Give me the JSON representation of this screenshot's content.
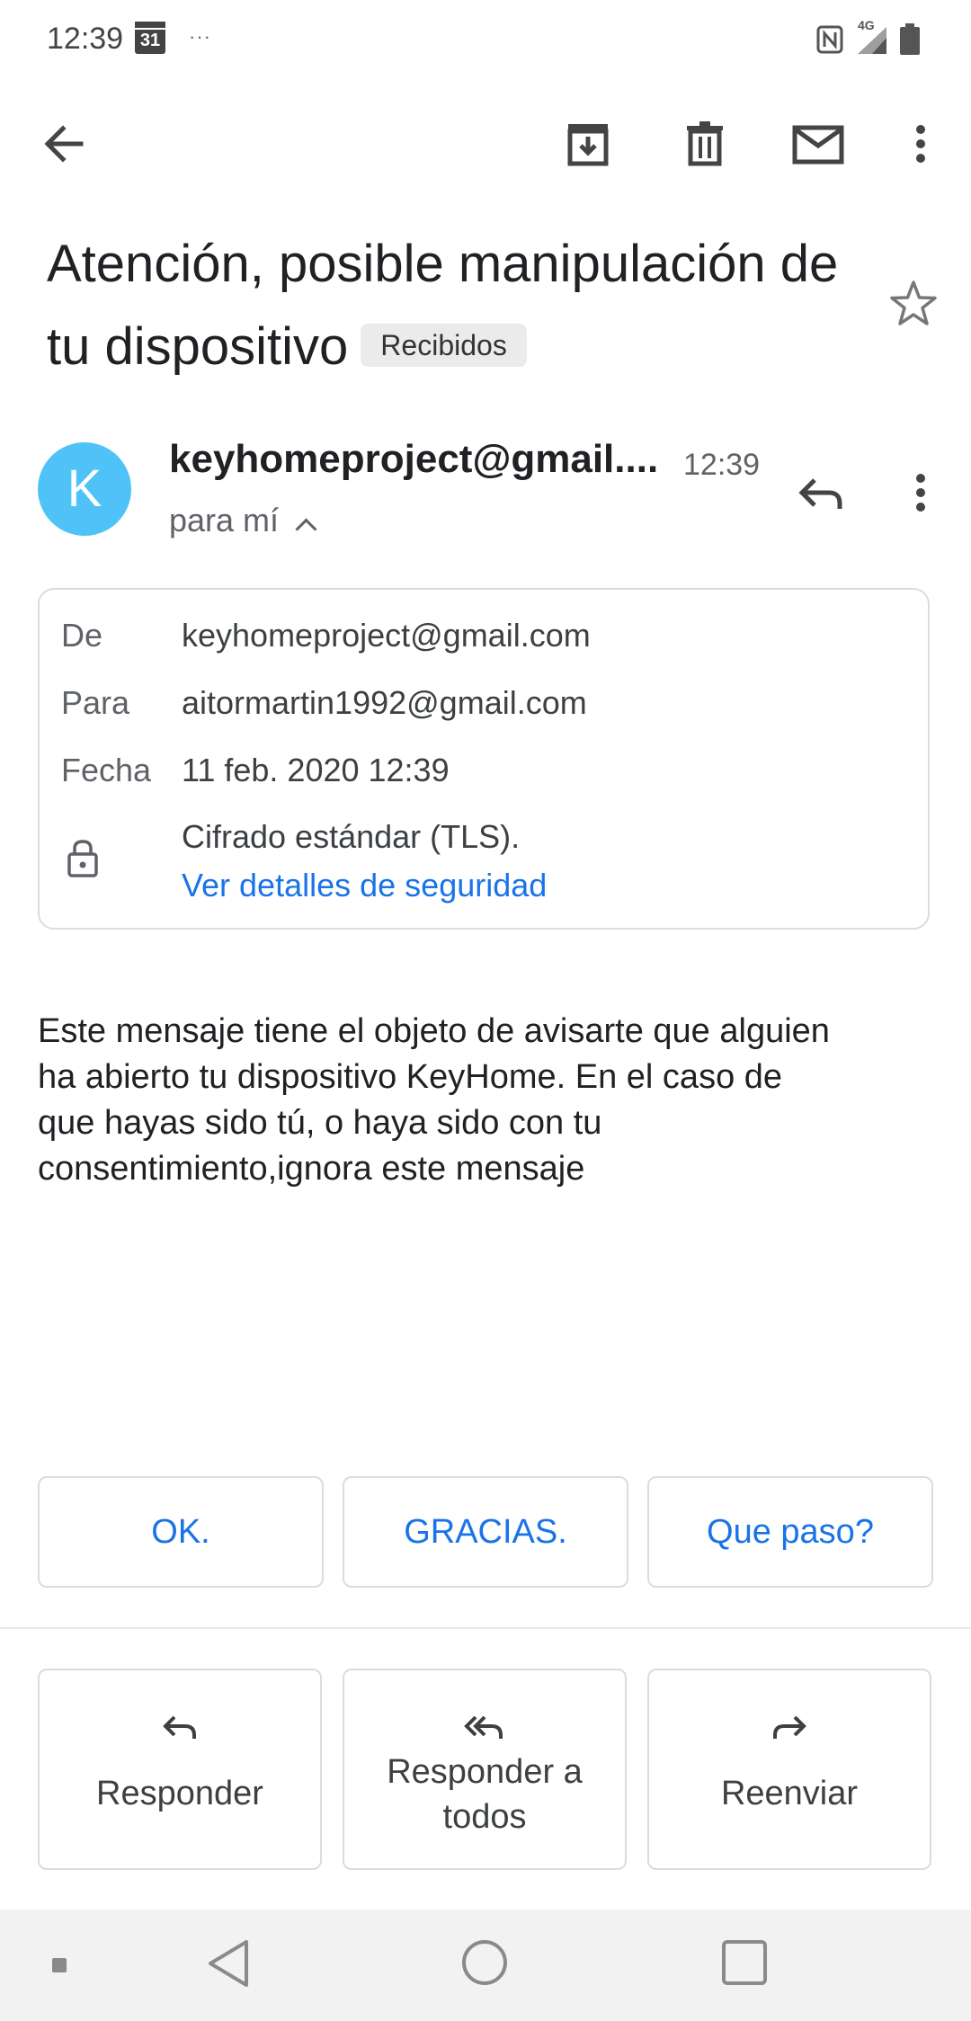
{
  "status_bar": {
    "time": "12:39",
    "calendar_day": "31",
    "overflow_dots": "···",
    "network_type": "4G",
    "icons": [
      "calendar-icon",
      "nfc-icon",
      "signal-icon",
      "battery-icon"
    ]
  },
  "toolbar": {
    "icons": [
      "back-arrow-icon",
      "archive-icon",
      "trash-icon",
      "mail-icon",
      "more-vert-icon"
    ]
  },
  "email": {
    "subject": "Atención, posible manipulación de tu dispositivo",
    "label_chip": "Recibidos",
    "sender_initial": "K",
    "sender_display": "keyhomeproject@gmail....",
    "time": "12:39",
    "recipient_summary": "para mí",
    "details": {
      "from_label": "De",
      "from_value": "keyhomeproject@gmail.com",
      "to_label": "Para",
      "to_value": "aitormartin1992@gmail.com",
      "date_label": "Fecha",
      "date_value": "11 feb. 2020 12:39",
      "encryption": "Cifrado estándar (TLS).",
      "security_link": "Ver detalles de seguridad"
    },
    "body_lines": [
      "Este mensaje tiene el objeto de avisarte que alguien",
      "ha abierto tu dispositivo KeyHome. En el caso de",
      "que hayas sido tú, o haya sido con tu",
      "consentimiento,ignora este mensaje"
    ]
  },
  "smart_replies": [
    "OK.",
    "GRACIAS.",
    "Que paso?"
  ],
  "actions": {
    "reply": "Responder",
    "reply_all_line1": "Responder a",
    "reply_all_line2": "todos",
    "forward": "Reenviar"
  },
  "colors": {
    "accent": "#1a73e8",
    "avatar": "#4fc3f7",
    "border": "#dadce0"
  }
}
